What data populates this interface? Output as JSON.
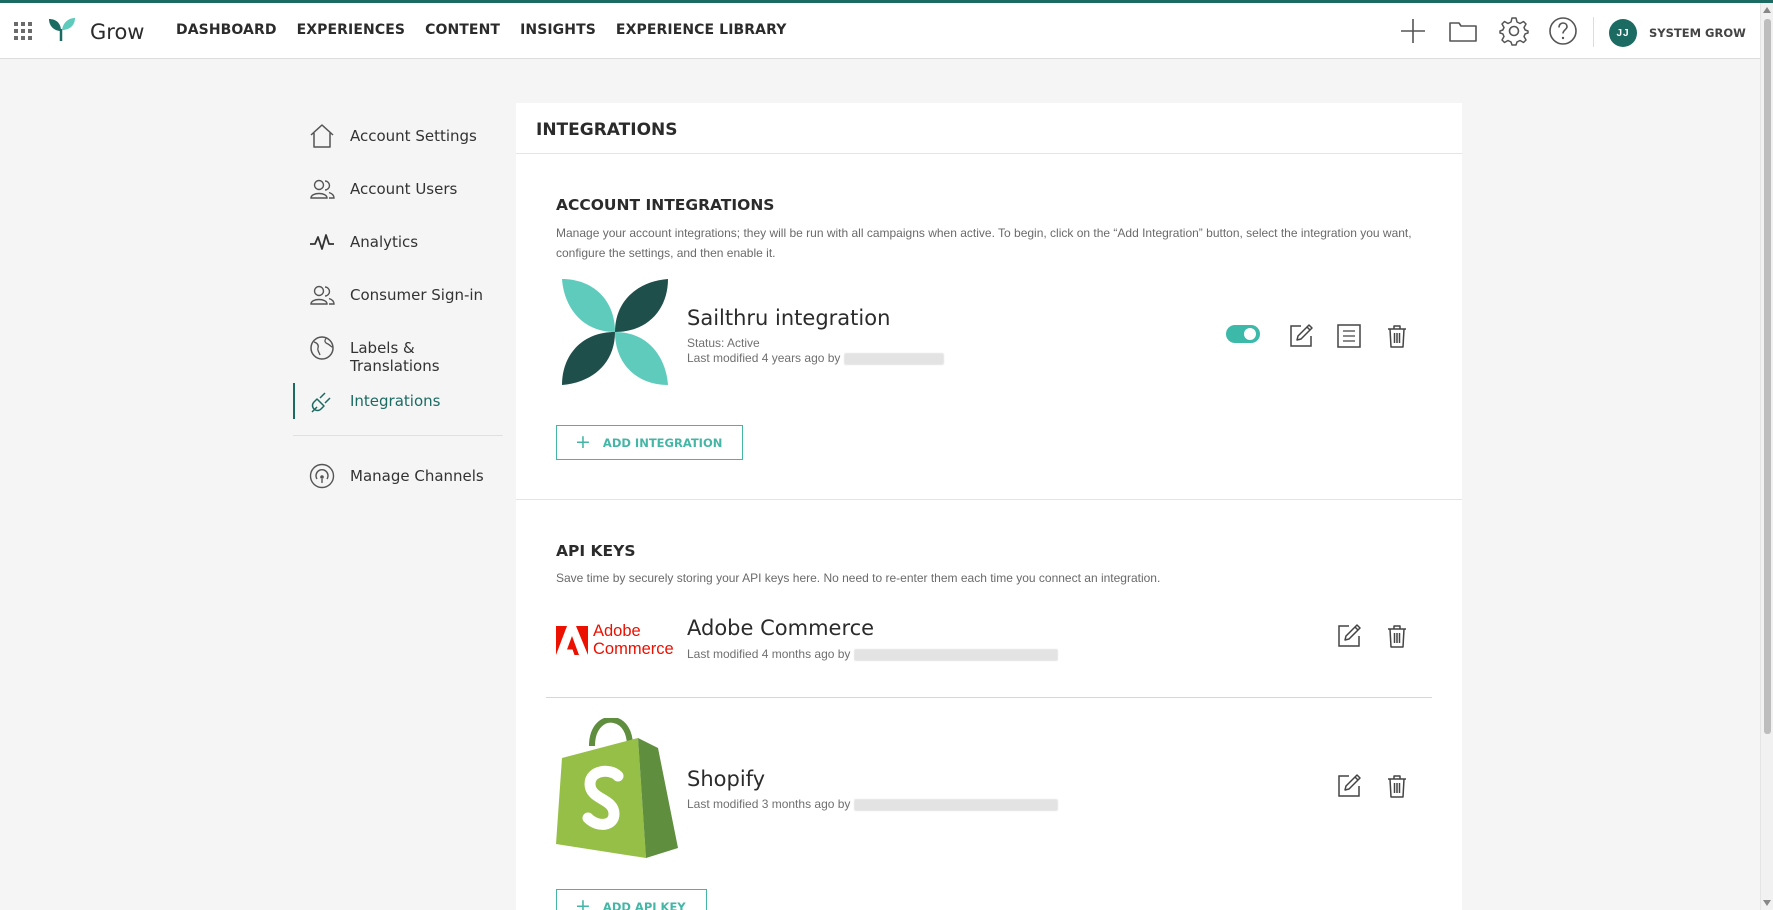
{
  "app": {
    "brand": "Grow",
    "user_initials": "JJ",
    "user_name": "SYSTEM GROW"
  },
  "nav": [
    "DASHBOARD",
    "EXPERIENCES",
    "CONTENT",
    "INSIGHTS",
    "EXPERIENCE LIBRARY"
  ],
  "top_icons": [
    "plus-icon",
    "folder-icon",
    "gear-icon",
    "help-icon"
  ],
  "sidebar": {
    "items": [
      {
        "label": "Account Settings",
        "icon": "home-icon"
      },
      {
        "label": "Account Users",
        "icon": "users-icon"
      },
      {
        "label": "Analytics",
        "icon": "pulse-icon"
      },
      {
        "label": "Consumer Sign-in",
        "icon": "users-icon"
      },
      {
        "label": "Labels & Translations",
        "icon": "globe-icon"
      },
      {
        "label": "Integrations",
        "icon": "plug-icon",
        "active": true
      },
      {
        "label": "Manage Channels",
        "icon": "broadcast-icon"
      }
    ]
  },
  "panel": {
    "title": "INTEGRATIONS",
    "account_integrations": {
      "title": "ACCOUNT INTEGRATIONS",
      "description": "Manage your account integrations; they will be run with all campaigns when active. To begin, click on the “Add Integration” button, select the integration you want, configure the settings, and then enable it.",
      "items": [
        {
          "name": "Sailthru integration",
          "status": "Status: Active",
          "modified": "Last modified 4 years ago by",
          "enabled": true
        }
      ],
      "add_button": "ADD INTEGRATION"
    },
    "api_keys": {
      "title": "API KEYS",
      "description": "Save time by securely storing your API keys here. No need to re-enter them each time you connect an integration.",
      "items": [
        {
          "name": "Adobe Commerce",
          "modified": "Last modified 4 months ago by",
          "logo_text": [
            "Adobe",
            "Commerce"
          ]
        },
        {
          "name": "Shopify",
          "modified": "Last modified 3 months ago by"
        }
      ],
      "add_button": "ADD API KEY"
    }
  },
  "colors": {
    "brand": "#1c6b63",
    "accent": "#45b6a6",
    "toggle": "#3db9a9",
    "adobe": "#eb1000",
    "shopify_light": "#95bf47",
    "shopify_dark": "#5e8e3e",
    "sailthru_dark": "#1f4f4b",
    "sailthru_light": "#5fcbbd"
  }
}
